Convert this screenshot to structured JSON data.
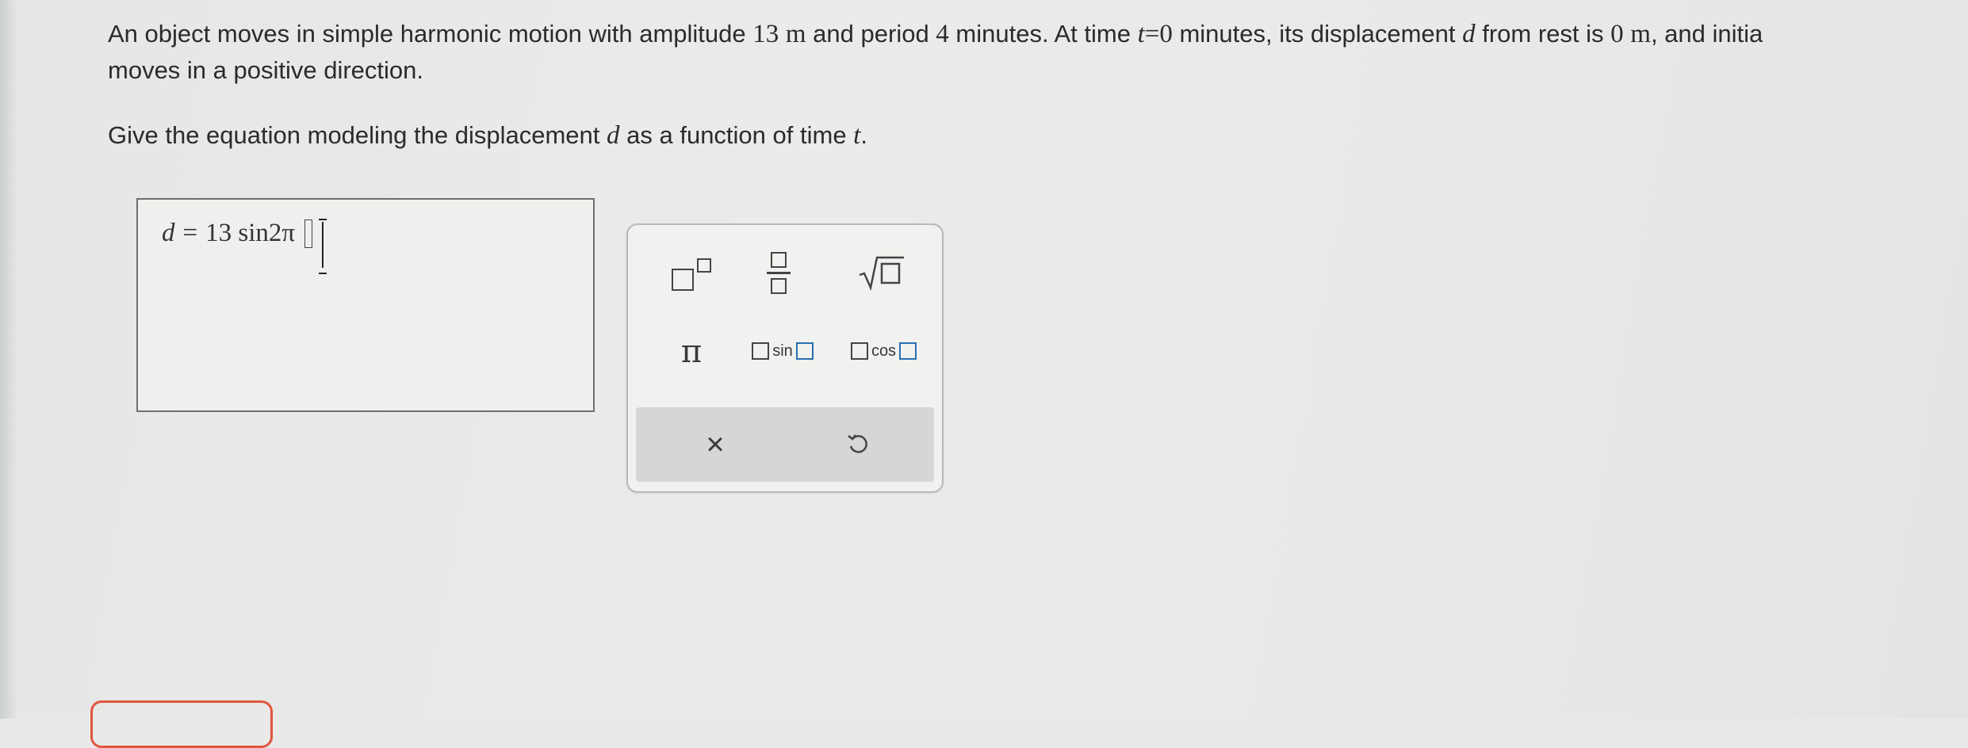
{
  "problem": {
    "line1_a": "An object moves in simple harmonic motion with amplitude ",
    "amplitude_value": "13",
    "amplitude_unit": "m",
    "line1_b": " and period ",
    "period_value": "4",
    "line1_c": " minutes. At time ",
    "time_var": "t",
    "time_eq": "=0",
    "line1_d": " minutes, its displacement ",
    "disp_var": "d",
    "line1_e": " from rest is ",
    "rest_value": "0",
    "rest_unit": "m",
    "line1_f": ", and initia",
    "line2": "moves in a positive direction."
  },
  "prompt": {
    "text_a": "Give the equation modeling the displacement ",
    "var_d": "d",
    "text_b": " as a function of time ",
    "var_t": "t",
    "text_c": "."
  },
  "answer": {
    "lhs": "d",
    "equals": "=",
    "rhs": "13 sin2π"
  },
  "palette": {
    "pi_label": "π",
    "sin_label": "sin",
    "cos_label": "cos",
    "clear_label": "×"
  }
}
